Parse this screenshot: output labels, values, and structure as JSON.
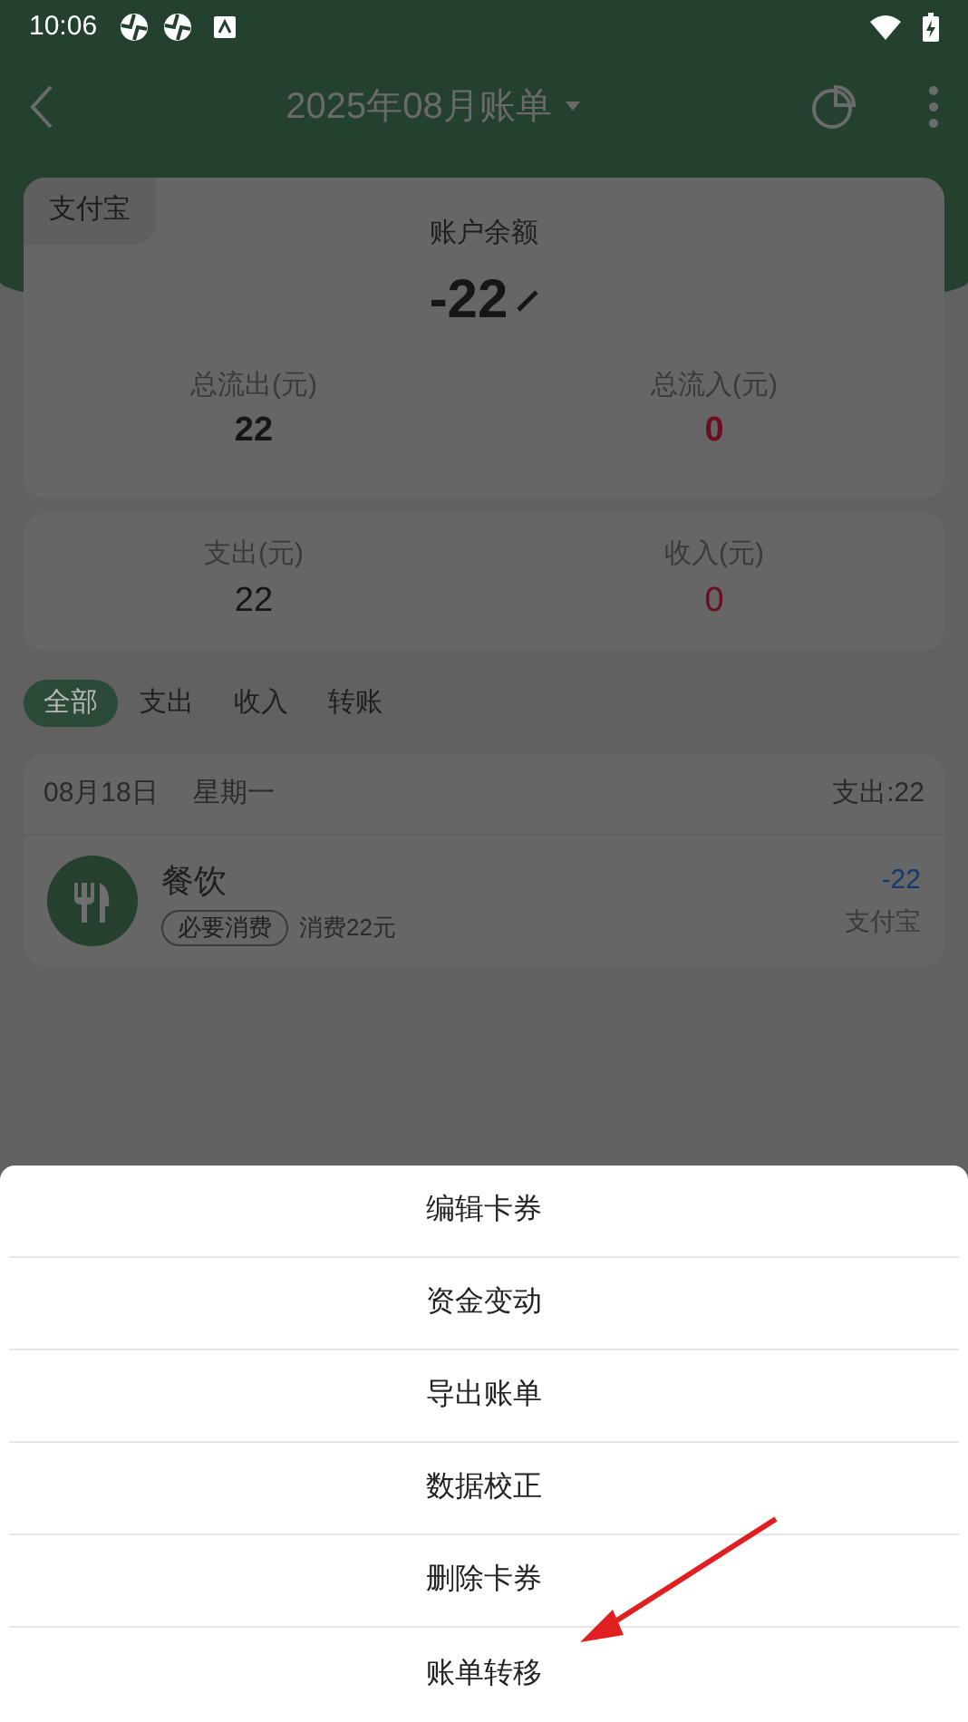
{
  "status_bar": {
    "time": "10:06"
  },
  "nav": {
    "title": "2025年08月账单"
  },
  "account_card": {
    "badge": "支付宝",
    "balance_label": "账户余额",
    "balance": "-22",
    "stats": [
      {
        "label": "总流出(元)",
        "value": "22",
        "kind": "out"
      },
      {
        "label": "总流入(元)",
        "value": "0",
        "kind": "in"
      }
    ]
  },
  "month_card": {
    "stats": [
      {
        "label": "支出(元)",
        "value": "22",
        "kind": "out"
      },
      {
        "label": "收入(元)",
        "value": "0",
        "kind": "in"
      }
    ]
  },
  "tabs": [
    {
      "label": "全部",
      "selected": true
    },
    {
      "label": "支出",
      "selected": false
    },
    {
      "label": "收入",
      "selected": false
    },
    {
      "label": "转账",
      "selected": false
    }
  ],
  "day_group": {
    "date": "08月18日",
    "weekday": "星期一",
    "total": "支出:22",
    "records": [
      {
        "category": "餐饮",
        "tag": "必要消费",
        "note": "消费22元",
        "amount": "-22",
        "account": "支付宝"
      }
    ]
  },
  "bottom_sheet": {
    "items": [
      "编辑卡券",
      "资金变动",
      "导出账单",
      "数据校正",
      "删除卡券",
      "账单转移"
    ]
  }
}
